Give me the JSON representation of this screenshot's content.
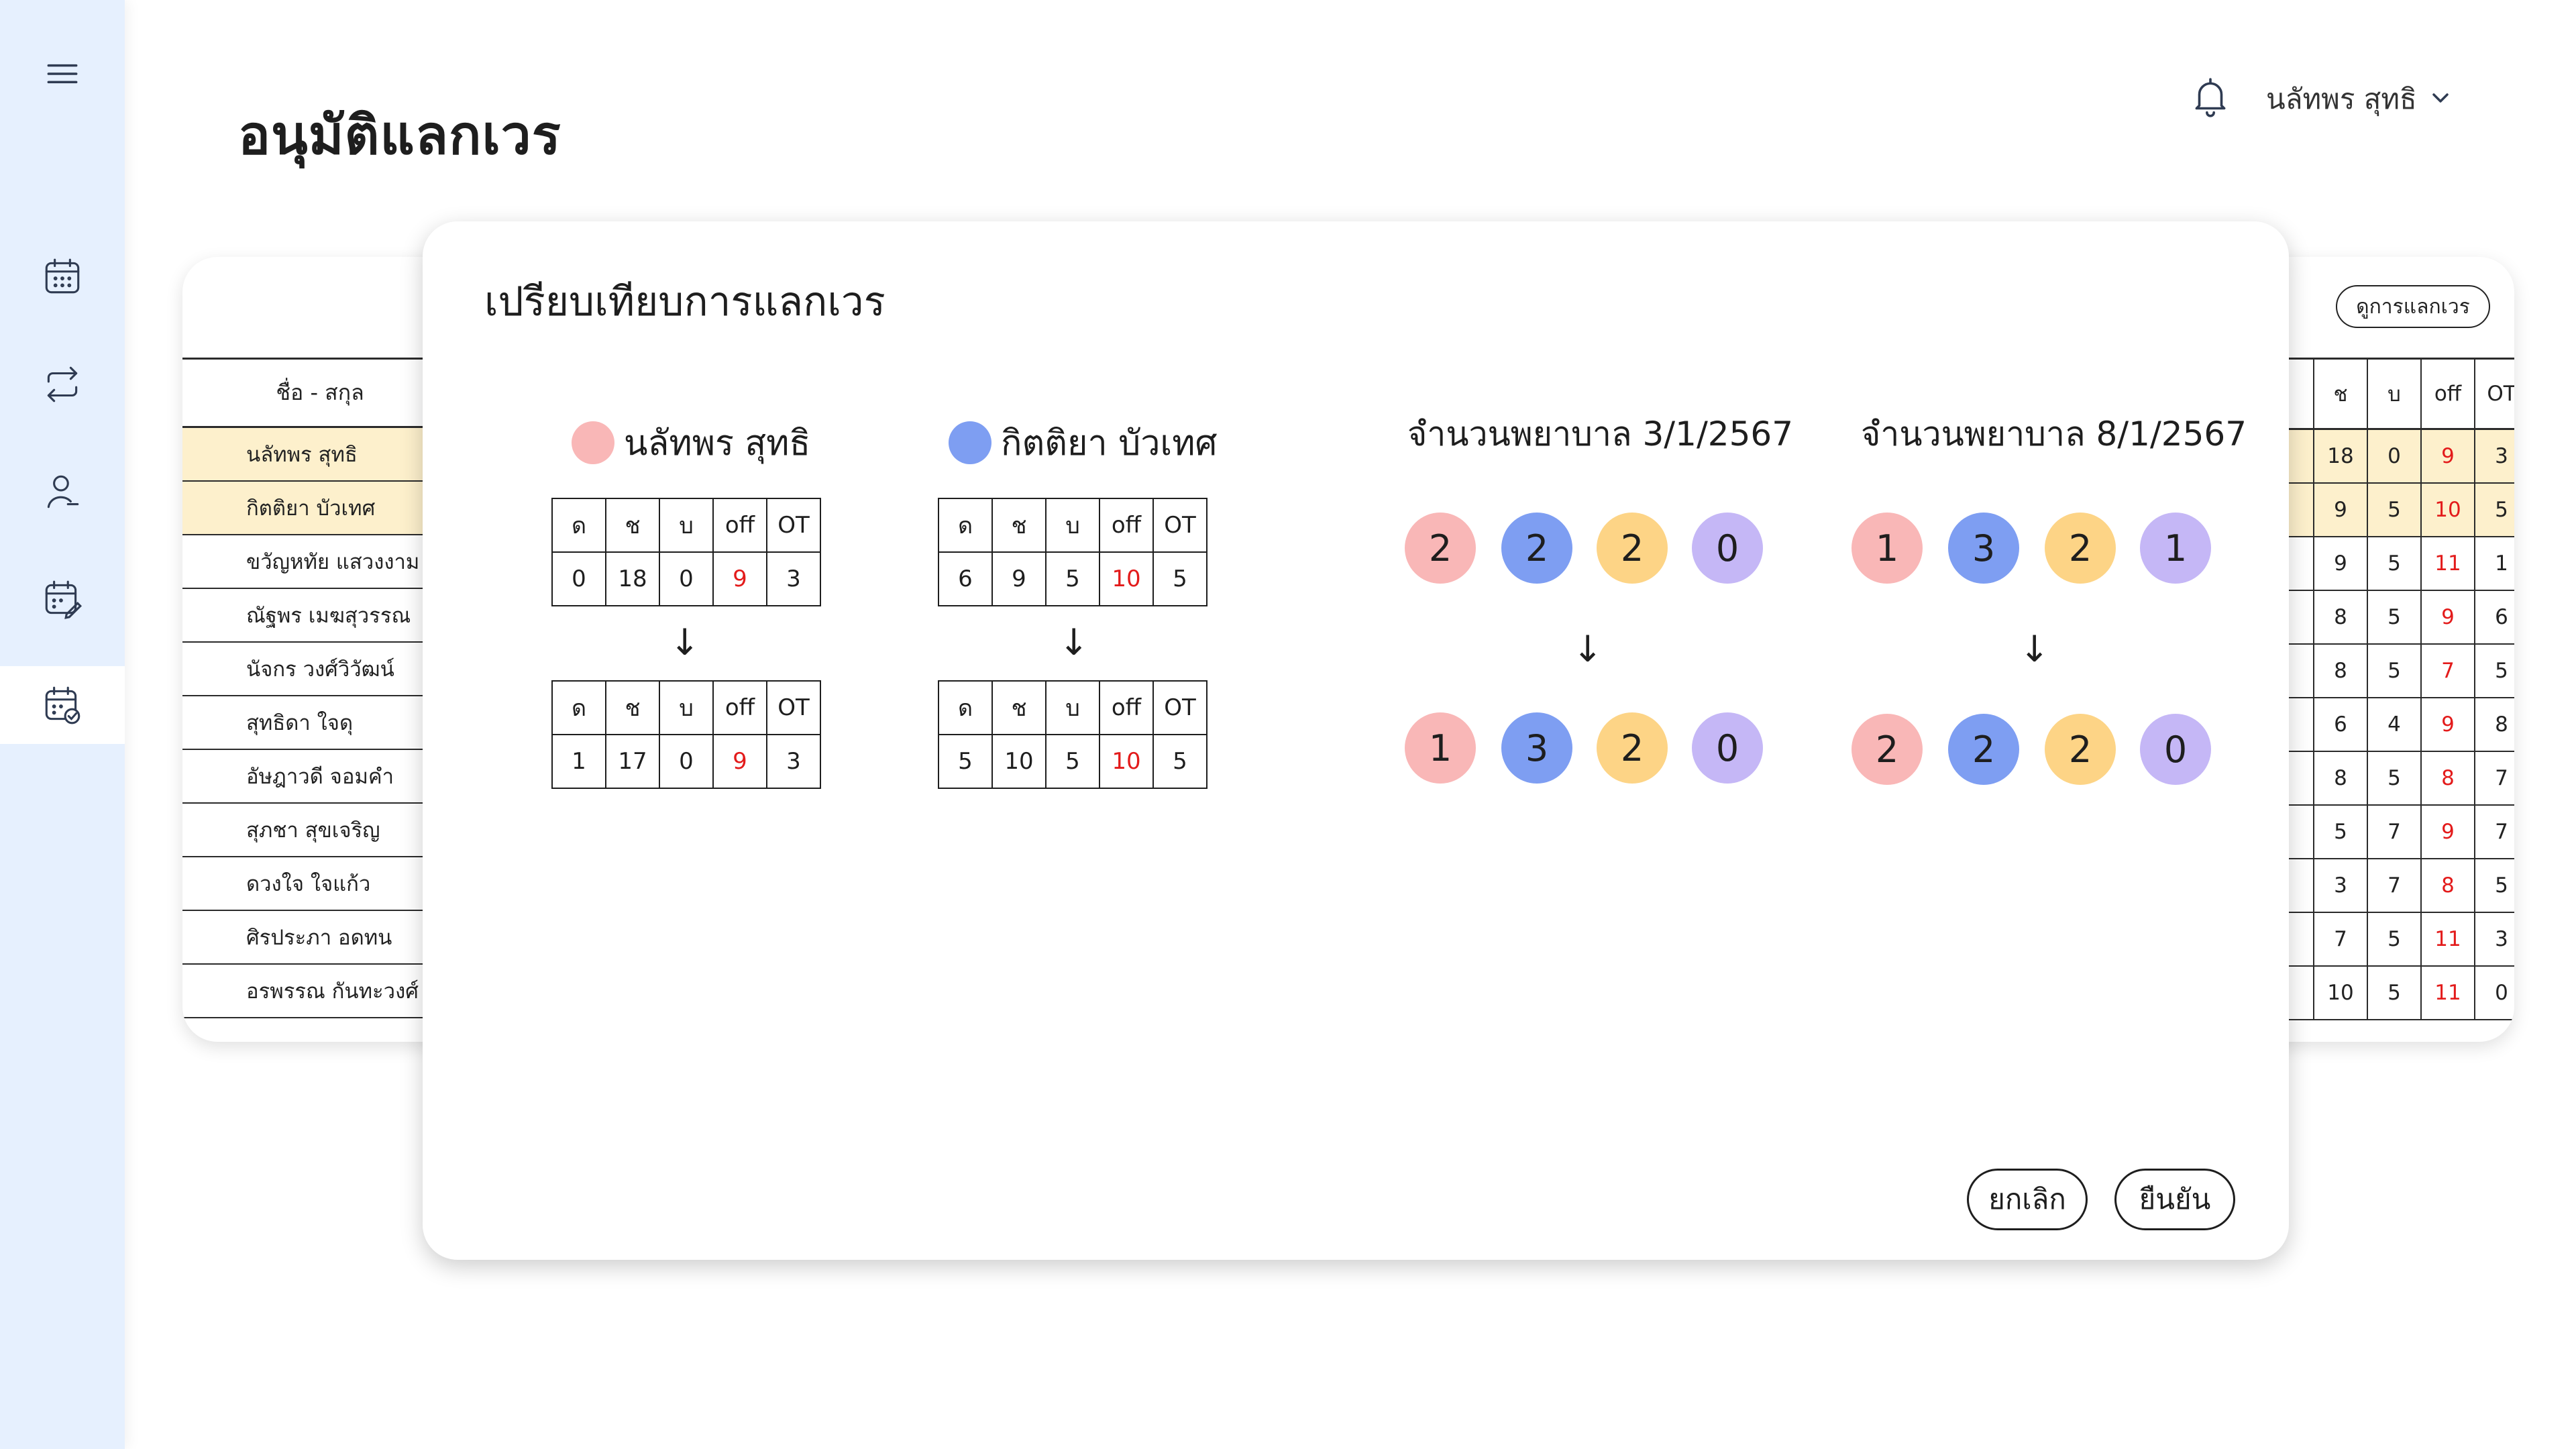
{
  "page": {
    "title": "อนุมัติแลกเวร"
  },
  "header": {
    "user_name": "นลัทพร สุทธิ"
  },
  "sidebar": {
    "items": [
      {
        "icon": "menu-icon"
      },
      {
        "icon": "calendar-icon"
      },
      {
        "icon": "swap-icon"
      },
      {
        "icon": "user-minus-icon"
      },
      {
        "icon": "calendar-edit-icon"
      },
      {
        "icon": "calendar-check-icon",
        "active": true
      }
    ]
  },
  "background_table": {
    "view_button_label": "ดูการแลกเวร",
    "name_header": "ชื่อ - สกุล",
    "names": [
      "นลัทพร สุทธิ",
      "กิตติยา บัวเทศ",
      "ขวัญหทัย แสวงงาม",
      "ณัฐพร เมฆสุวรรณ",
      "นัจกร วงศ์วิวัฒน์",
      "สุทธิดา ใจดุ",
      "อัษฎาวดี จอมคำ",
      "สุภชา สุขเจริญ",
      "ดวงใจ ใจแก้ว",
      "ศิรประภา อดทน",
      "อรพรรณ กันทะวงศ์"
    ],
    "highlighted_rows": [
      0,
      1
    ],
    "columns": [
      "",
      "ช",
      "บ",
      "off",
      "OT"
    ],
    "rows": [
      [
        "",
        "18",
        "0",
        "9",
        "3"
      ],
      [
        "",
        "9",
        "5",
        "10",
        "5"
      ],
      [
        "",
        "9",
        "5",
        "11",
        "1"
      ],
      [
        "",
        "8",
        "5",
        "9",
        "6"
      ],
      [
        "",
        "8",
        "5",
        "7",
        "5"
      ],
      [
        ")",
        "6",
        "4",
        "9",
        "8"
      ],
      [
        "",
        "8",
        "5",
        "8",
        "7"
      ],
      [
        "",
        "5",
        "7",
        "9",
        "7"
      ],
      [
        ")",
        "3",
        "7",
        "8",
        "5"
      ],
      [
        "",
        "7",
        "5",
        "11",
        "3"
      ],
      [
        "",
        "10",
        "5",
        "11",
        "0"
      ]
    ]
  },
  "modal": {
    "title": "เปรียบเทียบการแลกเวร",
    "arrow": "↓",
    "table_headers": [
      "ด",
      "ช",
      "บ",
      "off",
      "OT"
    ],
    "people": [
      {
        "name": "นลัทพร สุทธิ",
        "color": "#f9b7b7",
        "before": [
          "0",
          "18",
          "0",
          "9",
          "3"
        ],
        "after": [
          "1",
          "17",
          "0",
          "9",
          "3"
        ]
      },
      {
        "name": "กิตติยา บัวเทศ",
        "color": "#7e9ef2",
        "before": [
          "6",
          "9",
          "5",
          "10",
          "5"
        ],
        "after": [
          "5",
          "10",
          "5",
          "10",
          "5"
        ]
      }
    ],
    "nurse_counts": [
      {
        "title": "จำนวนพยาบาล 3/1/2567",
        "before": [
          "2",
          "2",
          "2",
          "0"
        ],
        "after": [
          "1",
          "3",
          "2",
          "0"
        ]
      },
      {
        "title": "จำนวนพยาบาล 8/1/2567",
        "before": [
          "1",
          "3",
          "2",
          "1"
        ],
        "after": [
          "2",
          "2",
          "2",
          "0"
        ]
      }
    ],
    "circle_colors": [
      "#f9b7b7",
      "#7e9ef2",
      "#fdd486",
      "#c5b7f6"
    ],
    "red_color": "#e31b1b",
    "cancel_label": "ยกเลิก",
    "confirm_label": "ยืนยัน"
  }
}
